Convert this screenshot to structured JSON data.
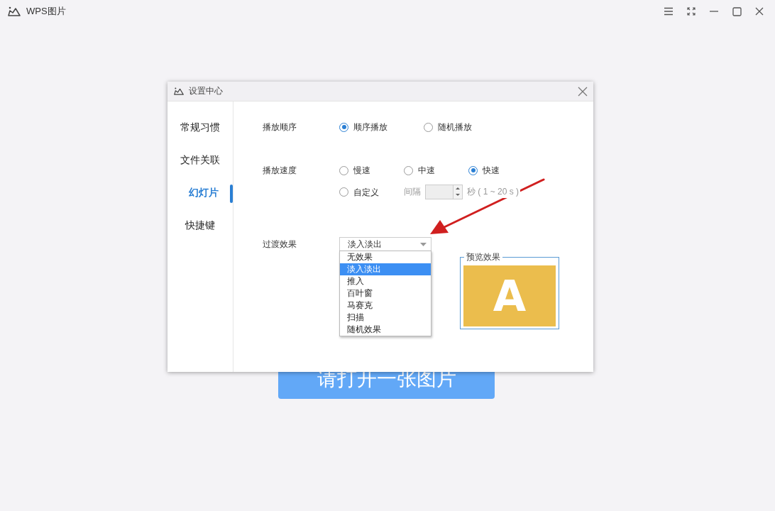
{
  "app": {
    "title": "WPS图片"
  },
  "background": {
    "open_button": "请打开一张图片"
  },
  "dialog": {
    "title": "设置中心",
    "sidebar": [
      {
        "label": "常规习惯",
        "selected": false
      },
      {
        "label": "文件关联",
        "selected": false
      },
      {
        "label": "幻灯片",
        "selected": true
      },
      {
        "label": "快捷键",
        "selected": false
      }
    ],
    "play_order": {
      "label": "播放顺序",
      "options": [
        {
          "label": "顺序播放",
          "selected": true
        },
        {
          "label": "随机播放",
          "selected": false
        }
      ]
    },
    "play_speed": {
      "label": "播放速度",
      "options": [
        {
          "label": "慢速",
          "selected": false
        },
        {
          "label": "中速",
          "selected": false
        },
        {
          "label": "快速",
          "selected": true
        },
        {
          "label": "自定义",
          "selected": false
        }
      ],
      "interval": {
        "label": "间隔",
        "disabled": true,
        "unit": "秒 ( 1 ~ 20 s )"
      }
    },
    "transition": {
      "label": "过渡效果",
      "value": "淡入淡出",
      "expanded": true,
      "options": [
        {
          "label": "无效果",
          "selected": false
        },
        {
          "label": "淡入淡出",
          "selected": true
        },
        {
          "label": "推入",
          "selected": false
        },
        {
          "label": "百叶窗",
          "selected": false
        },
        {
          "label": "马赛克",
          "selected": false
        },
        {
          "label": "扫描",
          "selected": false
        },
        {
          "label": "随机效果",
          "selected": false
        }
      ]
    },
    "preview": {
      "legend": "预览效果",
      "letter": "A"
    }
  }
}
